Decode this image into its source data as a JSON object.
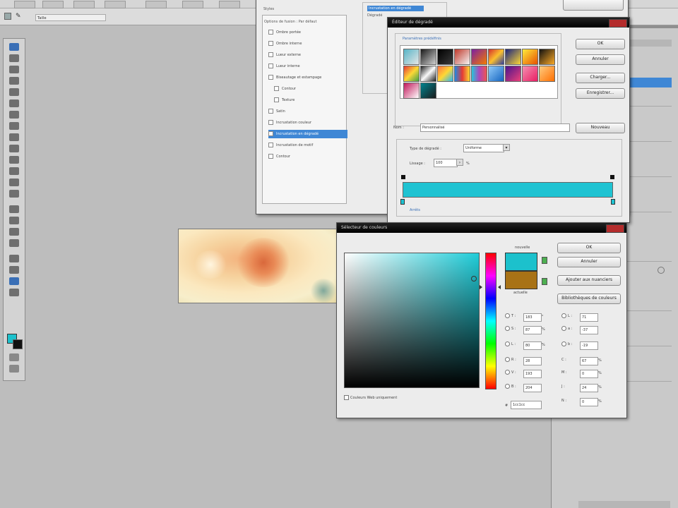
{
  "menubar": {
    "tabs": [
      "",
      "",
      "",
      "",
      "",
      "",
      ""
    ]
  },
  "optbar": {
    "tool_value": "Taille"
  },
  "layer_style": {
    "header": "Styles",
    "option_text": "Options de fusion : Par défaut",
    "items": [
      {
        "label": "Ombre portée",
        "selected": false
      },
      {
        "label": "Ombre interne",
        "selected": false
      },
      {
        "label": "Lueur externe",
        "selected": false
      },
      {
        "label": "Lueur interne",
        "selected": false
      },
      {
        "label": "Biseautage et estampage",
        "selected": false
      },
      {
        "label": "Contour",
        "selected": false
      },
      {
        "label": "Texture",
        "selected": false
      },
      {
        "label": "Satin",
        "selected": false
      },
      {
        "label": "Incrustation couleur",
        "selected": false
      },
      {
        "label": "Incrustation en dégradé",
        "selected": true
      },
      {
        "label": "Incrustation de motif",
        "selected": false
      },
      {
        "label": "Contour",
        "selected": false
      }
    ],
    "tab_label": "Incrustation en dégradé",
    "sub_label": "Dégradé"
  },
  "gradient_editor": {
    "title": "Éditeur de dégradé",
    "presets_label": "Paramètres prédéfinis",
    "ok": "OK",
    "cancel": "Annuler",
    "load": "Charger...",
    "save": "Enregistrer...",
    "name_label": "Nom :",
    "name_value": "Personnalisé",
    "new_button": "Nouveau",
    "type_label": "Type de dégradé :",
    "type_value": "Uniforme",
    "smooth_label": "Lissage :",
    "smooth_value": "100",
    "percent": "%",
    "stops_label": "Arrêts",
    "gradient_color": "#1fc3d2"
  },
  "color_picker": {
    "title": "Sélecteur de couleurs",
    "ok": "OK",
    "cancel": "Annuler",
    "add_swatch": "Ajouter aux nuanciers",
    "libraries": "Bibliothèques de couleurs",
    "new_label": "nouvelle",
    "current_label": "actuelle",
    "new_color": "#1cc1cc",
    "current_color": "#a87216",
    "web_only": "Couleurs Web uniquement",
    "hsb": [
      {
        "label": "T :",
        "value": "183",
        "unit": "°"
      },
      {
        "label": "S :",
        "value": "87",
        "unit": "%"
      },
      {
        "label": "L :",
        "value": "80",
        "unit": "%"
      }
    ],
    "rgb": [
      {
        "label": "R :",
        "value": "28"
      },
      {
        "label": "V :",
        "value": "193"
      },
      {
        "label": "B :",
        "value": "204"
      }
    ],
    "lab": [
      {
        "label": "L :",
        "value": "71"
      },
      {
        "label": "a :",
        "value": "-37"
      },
      {
        "label": "b :",
        "value": "-19"
      }
    ],
    "cmyk": [
      {
        "label": "C :",
        "value": "67",
        "unit": "%"
      },
      {
        "label": "M :",
        "value": "0",
        "unit": "%"
      },
      {
        "label": "J :",
        "value": "24",
        "unit": "%"
      },
      {
        "label": "N :",
        "value": "0",
        "unit": "%"
      }
    ],
    "hex_label": "#",
    "hex_value": "1cc1cc"
  }
}
